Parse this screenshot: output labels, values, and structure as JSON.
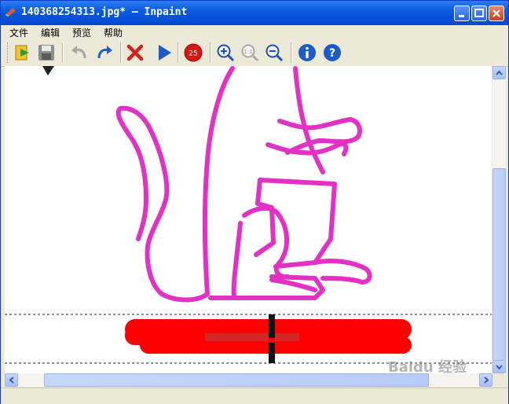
{
  "window": {
    "title": "140368254313.jpg* — Inpaint"
  },
  "menu": {
    "items": [
      "文件",
      "编辑",
      "预览",
      "帮助"
    ]
  },
  "toolbar": {
    "icons": [
      "open-icon",
      "save-icon",
      "undo-icon",
      "redo-icon",
      "delete-icon",
      "run-icon",
      "marker-size-icon",
      "zoom-in-icon",
      "zoom-actual-icon",
      "zoom-out-icon",
      "info-icon",
      "help-icon"
    ],
    "marker_size": "25"
  },
  "canvas": {
    "image": "pink kangaroo outline with red selection mask at bottom"
  },
  "watermark": {
    "text": "Baidu 经验"
  },
  "colors": {
    "titlebar": "#0a5be0",
    "outline": "#e020c0",
    "mask": "#ff0000"
  }
}
